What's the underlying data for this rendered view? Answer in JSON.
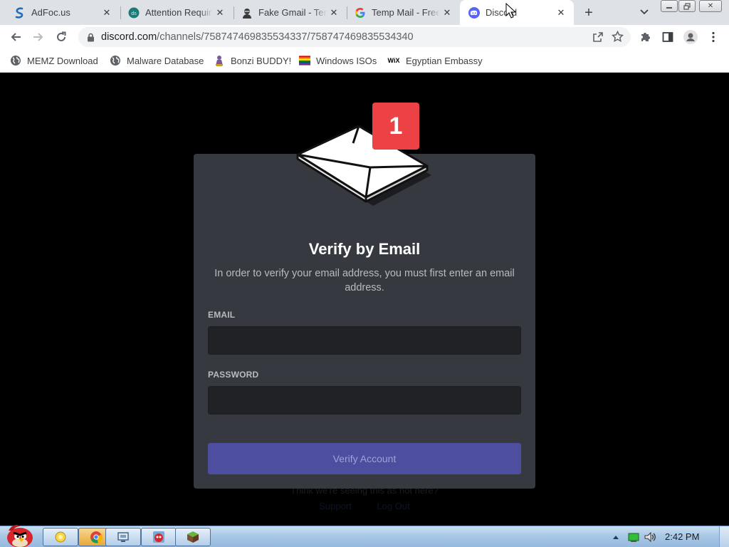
{
  "browser": {
    "tabs": [
      {
        "title": "AdFoc.us",
        "icon": "adfocus-icon",
        "active": false
      },
      {
        "title": "Attention Required! | Cloudflare",
        "icon": "cloudflare-icon",
        "active": false
      },
      {
        "title": "Fake Gmail - Temp",
        "icon": "spy-icon",
        "active": false
      },
      {
        "title": "Temp Mail - Free",
        "icon": "google-icon",
        "active": false
      },
      {
        "title": "Discord",
        "icon": "discord-icon",
        "active": true
      }
    ],
    "url_host": "discord.com",
    "url_path": "/channels/758747469835534337/758747469835534340"
  },
  "bookmarks": [
    {
      "label": "MEMZ Download",
      "icon": "globe-icon"
    },
    {
      "label": "Malware Database",
      "icon": "globe-icon"
    },
    {
      "label": "Bonzi BUDDY!",
      "icon": "bonzi-icon"
    },
    {
      "label": "Windows ISOs",
      "icon": "rainbow-flag-icon"
    },
    {
      "label": "Egyptian Embassy",
      "icon": "wix-icon"
    }
  ],
  "wix_label": "WiX",
  "dialog": {
    "badge": "1",
    "title": "Verify by Email",
    "description": "In order to verify your email address, you must first enter an email address.",
    "email_label": "EMAIL",
    "email_value": "",
    "password_label": "PASSWORD",
    "password_value": "",
    "button_label": "Verify Account"
  },
  "behind": {
    "text": "Think we're seeing this as not here?",
    "links": [
      "Support",
      "Log Out"
    ]
  },
  "taskbar": {
    "clock": "2:42 PM",
    "items": [
      "explorer",
      "chrome",
      "screen-capture",
      "angry-birds",
      "minecraft"
    ]
  },
  "colors": {
    "card_bg": "#36393f",
    "input_bg": "#202225",
    "button_bg": "#4e4ea0",
    "badge_bg": "#ed4245"
  }
}
